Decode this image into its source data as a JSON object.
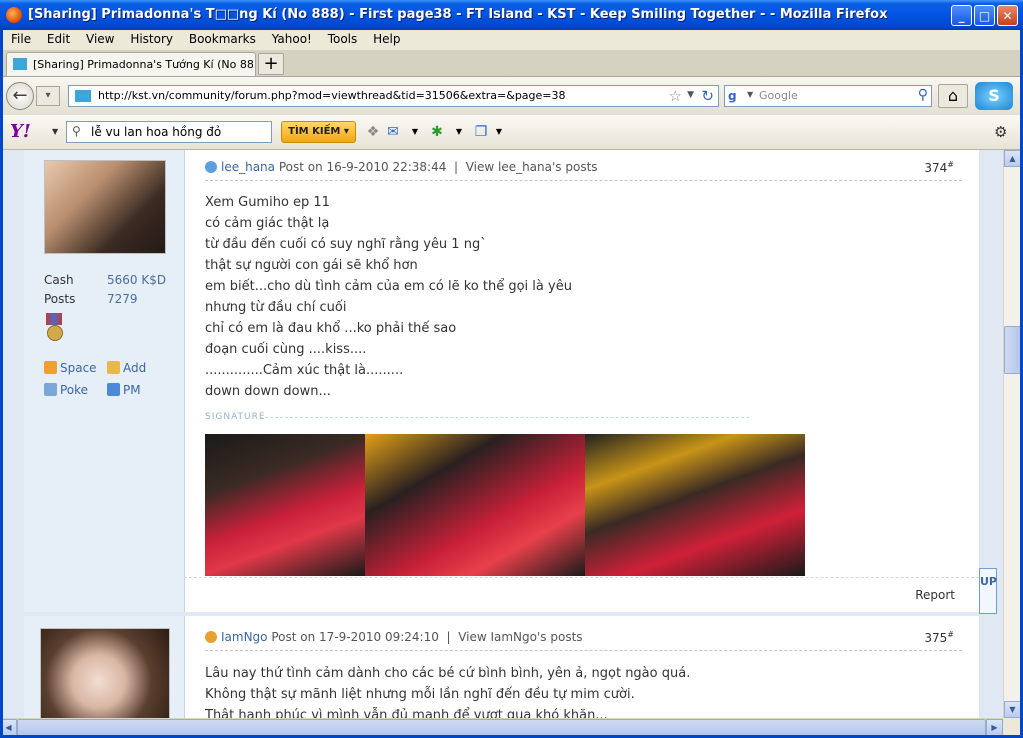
{
  "window": {
    "title": "[Sharing] Primadonna's T□□ng Kí (No 888) - First page38 - FT Island - KST - Keep Smiling Together - - Mozilla Firefox",
    "minimize": "_",
    "maximize": "□",
    "close": "✕"
  },
  "menu": [
    "File",
    "Edit",
    "View",
    "History",
    "Bookmarks",
    "Yahoo!",
    "Tools",
    "Help"
  ],
  "tab": {
    "title": "[Sharing] Primadonna's Tướng Kí (No 888) - ...",
    "new_tab": "+"
  },
  "nav": {
    "url": "http://kst.vn/community/forum.php?mod=viewthread&tid=31506&extra=&page=38",
    "search_placeholder": "Google"
  },
  "yahoo_toolbar": {
    "logo": "Y!",
    "search_value": "lễ vu lan hoa hồng đỏ",
    "search_button": "TÌM KIẾM ▾"
  },
  "posts": [
    {
      "user": "lee_hana",
      "post_on": "Post on 16-9-2010 22:38:44",
      "view_posts": "View lee_hana's posts",
      "number": "374",
      "number_sup": "#",
      "cash_label": "Cash",
      "cash_value": "5660 K$D",
      "posts_label": "Posts",
      "posts_value": "7279",
      "links": [
        "Space",
        "Add",
        "Poke",
        "PM"
      ],
      "lines": [
        "Xem Gumiho ep 11",
        "có cảm giác thật lạ",
        "từ đầu đến cuối có suy nghĩ rằng yêu 1 ng`",
        "thật sự người con gái sẽ khổ hơn",
        "em biết...cho dù tình cảm của em có lẽ ko thể gọi là yêu",
        "nhưng từ đầu chí cuối",
        "chỉ có em là đau khổ ...ko phải thế sao",
        "đoạn cuối cùng ....kiss....",
        "..............Cảm xúc thật là.........",
        "down down down..."
      ],
      "signature_label": "SIGNATURE",
      "report": "Report"
    },
    {
      "user": "IamNgo",
      "post_on": "Post on 17-9-2010 09:24:10",
      "view_posts": "View IamNgo's posts",
      "number": "375",
      "number_sup": "#",
      "lines": [
        "Lâu nay thứ tình cảm dành cho các bé cứ bình bình, yên ả, ngọt ngào quá.",
        "Không thật sự mãnh liệt nhưng mỗi lần nghĩ đến đều tự mim cười.",
        "Thật hạnh phúc vì mình vẫn đủ mạnh để vượt qua khó khăn..."
      ]
    }
  ],
  "up_button": "UP",
  "colors": {
    "title_blue": "#0054e3",
    "link_blue": "#3a66a6",
    "sidebar_bg": "#e6eef7"
  }
}
